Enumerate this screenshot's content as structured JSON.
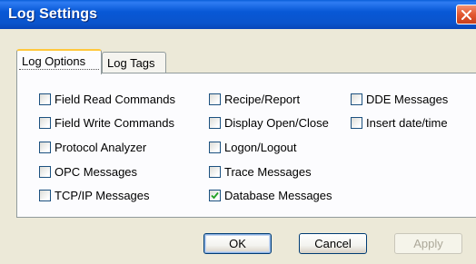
{
  "window": {
    "title": "Log Settings"
  },
  "tabs": [
    {
      "label": "Log Options",
      "active": true
    },
    {
      "label": "Log Tags",
      "active": false
    }
  ],
  "options": {
    "field_read": {
      "label": "Field Read Commands",
      "checked": false
    },
    "field_write": {
      "label": "Field Write Commands",
      "checked": false
    },
    "protocol_analyzer": {
      "label": "Protocol Analyzer",
      "checked": false
    },
    "opc_messages": {
      "label": "OPC Messages",
      "checked": false
    },
    "tcpip_messages": {
      "label": "TCP/IP Messages",
      "checked": false
    },
    "recipe_report": {
      "label": "Recipe/Report",
      "checked": false
    },
    "display_open_close": {
      "label": "Display Open/Close",
      "checked": false
    },
    "logon_logout": {
      "label": "Logon/Logout",
      "checked": false
    },
    "trace_messages": {
      "label": "Trace Messages",
      "checked": false
    },
    "database_messages": {
      "label": "Database Messages",
      "checked": true
    },
    "dde_messages": {
      "label": "DDE Messages",
      "checked": false
    },
    "insert_datetime": {
      "label": "Insert date/time",
      "checked": false
    }
  },
  "buttons": {
    "ok": "OK",
    "cancel": "Cancel",
    "apply": "Apply"
  },
  "colors": {
    "titlebar": "#0a54cc",
    "dialog_bg": "#ece9d8",
    "active_tab_accent": "#ffc83c",
    "checkmark": "#21a121",
    "close_button": "#e2572f"
  }
}
